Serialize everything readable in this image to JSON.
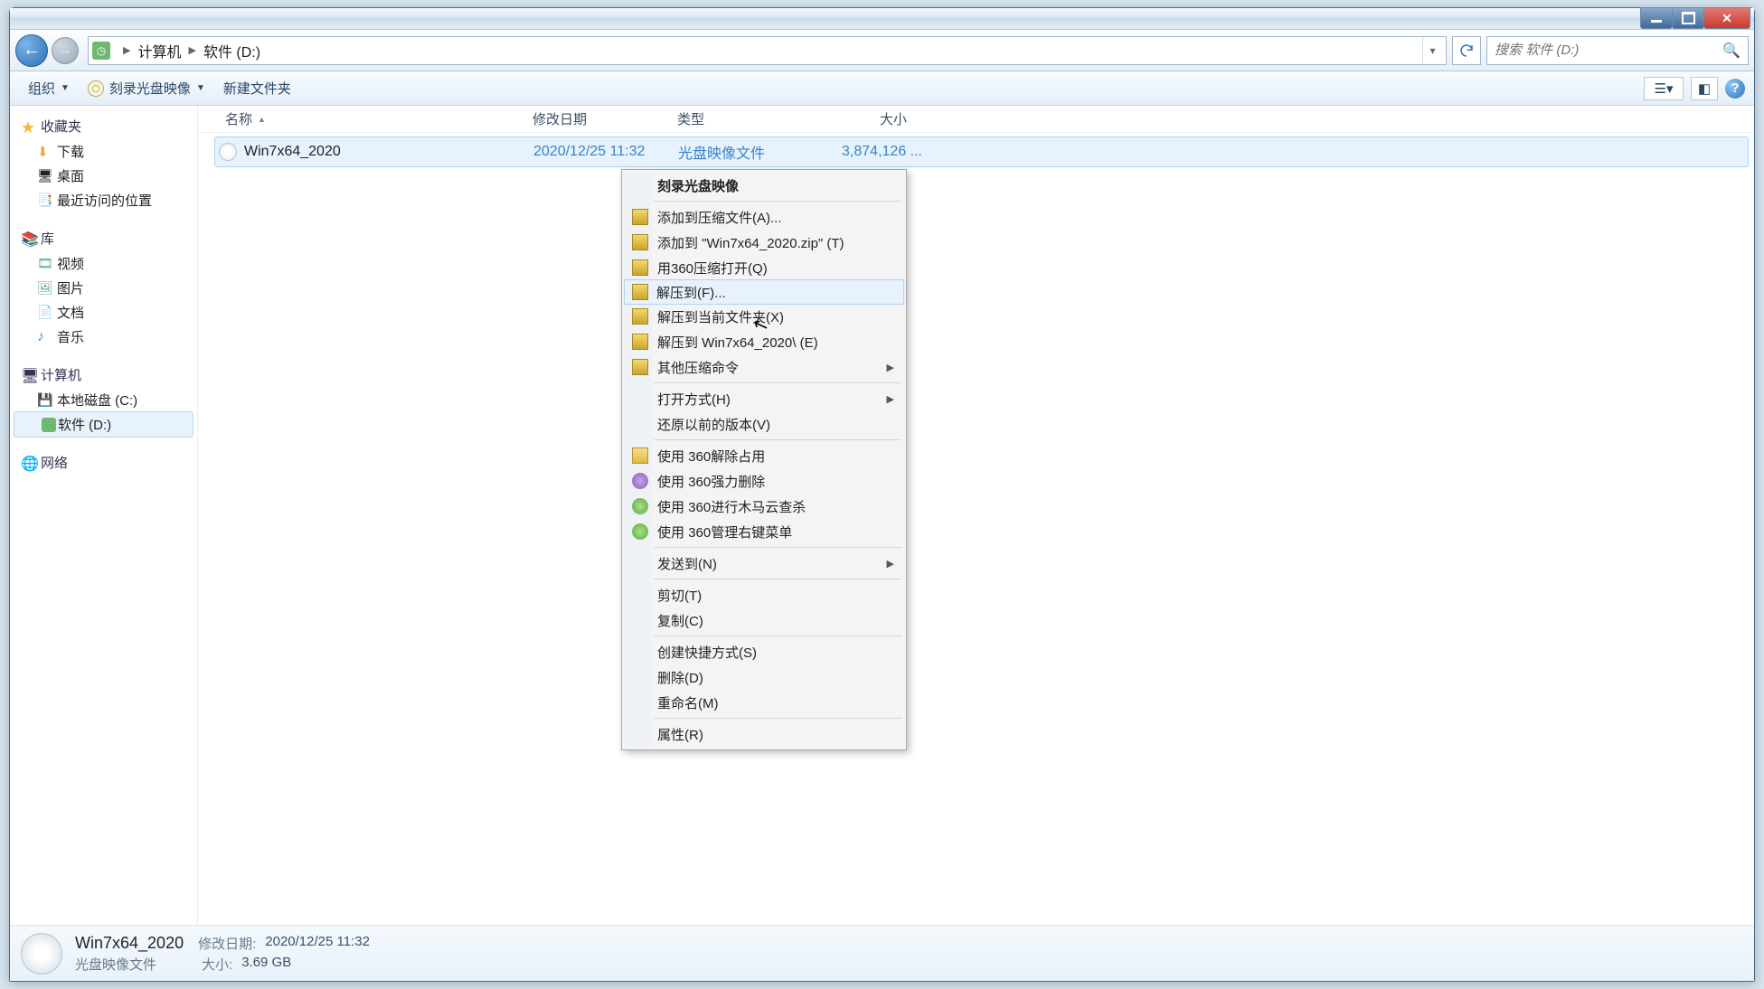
{
  "window_controls": {
    "min": "min",
    "max": "max",
    "close": "close"
  },
  "breadcrumb": {
    "root": "计算机",
    "current": "软件 (D:)"
  },
  "search": {
    "placeholder": "搜索 软件 (D:)"
  },
  "toolbar": {
    "organize": "组织",
    "burn": "刻录光盘映像",
    "new_folder": "新建文件夹"
  },
  "sidebar": {
    "favorites": {
      "title": "收藏夹",
      "downloads": "下载",
      "desktop": "桌面",
      "recent": "最近访问的位置"
    },
    "libraries": {
      "title": "库",
      "videos": "视频",
      "pictures": "图片",
      "documents": "文档",
      "music": "音乐"
    },
    "computer": {
      "title": "计算机",
      "local_c": "本地磁盘 (C:)",
      "software_d": "软件 (D:)"
    },
    "network": {
      "title": "网络"
    }
  },
  "columns": {
    "name": "名称",
    "date": "修改日期",
    "type": "类型",
    "size": "大小"
  },
  "file": {
    "name": "Win7x64_2020",
    "date": "2020/12/25 11:32",
    "type": "光盘映像文件",
    "size": "3,874,126 ..."
  },
  "context_menu": {
    "burn_image": "刻录光盘映像",
    "add_archive": "添加到压缩文件(A)...",
    "add_zip": "添加到 \"Win7x64_2020.zip\" (T)",
    "open_360zip": "用360压缩打开(Q)",
    "extract_to": "解压到(F)...",
    "extract_here": "解压到当前文件夹(X)",
    "extract_folder": "解压到 Win7x64_2020\\ (E)",
    "other_zip": "其他压缩命令",
    "open_with": "打开方式(H)",
    "restore_prev": "还原以前的版本(V)",
    "unlock_360": "使用 360解除占用",
    "force_del_360": "使用 360强力删除",
    "scan_360": "使用 360进行木马云查杀",
    "menu_360": "使用 360管理右键菜单",
    "send_to": "发送到(N)",
    "cut": "剪切(T)",
    "copy": "复制(C)",
    "shortcut": "创建快捷方式(S)",
    "delete": "删除(D)",
    "rename": "重命名(M)",
    "properties": "属性(R)"
  },
  "details": {
    "title": "Win7x64_2020",
    "type": "光盘映像文件",
    "date_label": "修改日期:",
    "date": "2020/12/25 11:32",
    "size_label": "大小:",
    "size": "3.69 GB"
  }
}
